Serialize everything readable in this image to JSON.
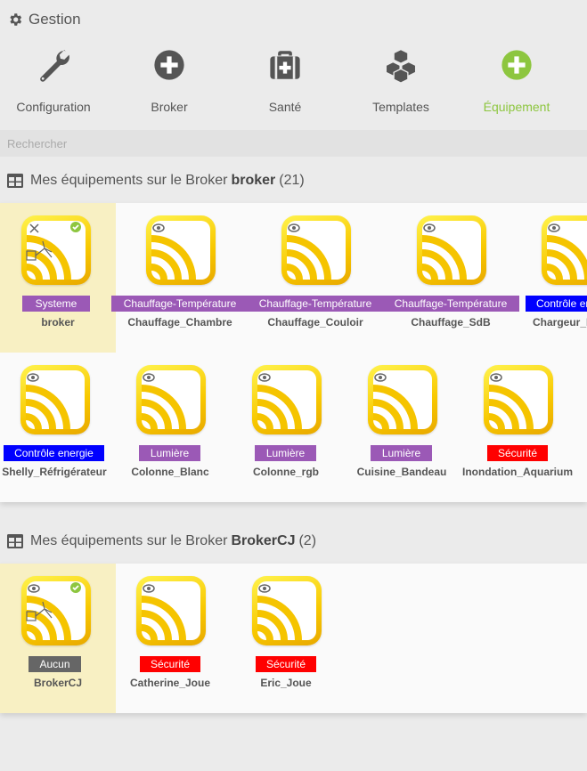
{
  "header": {
    "title": "Gestion",
    "icon": "gear-icon"
  },
  "actions": [
    {
      "label": "Configuration",
      "icon": "wrench-icon",
      "color": "#555555"
    },
    {
      "label": "Broker",
      "icon": "plus-circle-icon",
      "color": "#555555"
    },
    {
      "label": "Santé",
      "icon": "medkit-icon",
      "color": "#555555"
    },
    {
      "label": "Templates",
      "icon": "cubes-icon",
      "color": "#555555"
    },
    {
      "label": "Équipement",
      "icon": "plus-circle-icon",
      "color": "#8dc63f"
    }
  ],
  "search": {
    "placeholder": "Rechercher"
  },
  "sections": [
    {
      "prefix": "Mes équipements sur le Broker",
      "broker": "broker",
      "count": "(21)",
      "icon": "table-icon",
      "items": [
        {
          "name": "broker",
          "category": "Systeme",
          "category_color": "#9b59b6",
          "selected": true,
          "icon": "mqtt-broker-icon"
        },
        {
          "name": "Chauffage_Chambre",
          "category": "Chauffage-Température",
          "category_color": "#9b59b6",
          "icon": "mqtt-device-icon"
        },
        {
          "name": "Chauffage_Couloir",
          "category": "Chauffage-Température",
          "category_color": "#9b59b6",
          "icon": "mqtt-device-icon"
        },
        {
          "name": "Chauffage_SdB",
          "category": "Chauffage-Température",
          "category_color": "#9b59b6",
          "icon": "mqtt-device-icon"
        },
        {
          "name": "Chargeur_B",
          "category": "Contrôle er",
          "category_color": "#0000ff",
          "icon": "mqtt-device-icon"
        },
        {
          "name": "Shelly_Réfrigérateur",
          "category": "Contrôle energie",
          "category_color": "#0000ff",
          "icon": "mqtt-device-icon"
        },
        {
          "name": "Colonne_Blanc",
          "category": "Lumière",
          "category_color": "#9b59b6",
          "icon": "mqtt-device-icon"
        },
        {
          "name": "Colonne_rgb",
          "category": "Lumière",
          "category_color": "#9b59b6",
          "icon": "mqtt-device-icon"
        },
        {
          "name": "Cuisine_Bandeau",
          "category": "Lumière",
          "category_color": "#9b59b6",
          "icon": "mqtt-device-icon"
        },
        {
          "name": "Inondation_Aquarium",
          "category": "Sécurité",
          "category_color": "#ff0000",
          "icon": "mqtt-device-icon"
        }
      ]
    },
    {
      "prefix": "Mes équipements sur le Broker",
      "broker": "BrokerCJ",
      "count": "(2)",
      "icon": "table-icon",
      "items": [
        {
          "name": "BrokerCJ",
          "category": "Aucun",
          "category_color": "#666666",
          "selected": true,
          "icon": "mqtt-broker-icon"
        },
        {
          "name": "Catherine_Joue",
          "category": "Sécurité",
          "category_color": "#ff0000",
          "icon": "mqtt-device-icon"
        },
        {
          "name": "Eric_Joue",
          "category": "Sécurité",
          "category_color": "#ff0000",
          "icon": "mqtt-device-icon"
        }
      ]
    }
  ]
}
